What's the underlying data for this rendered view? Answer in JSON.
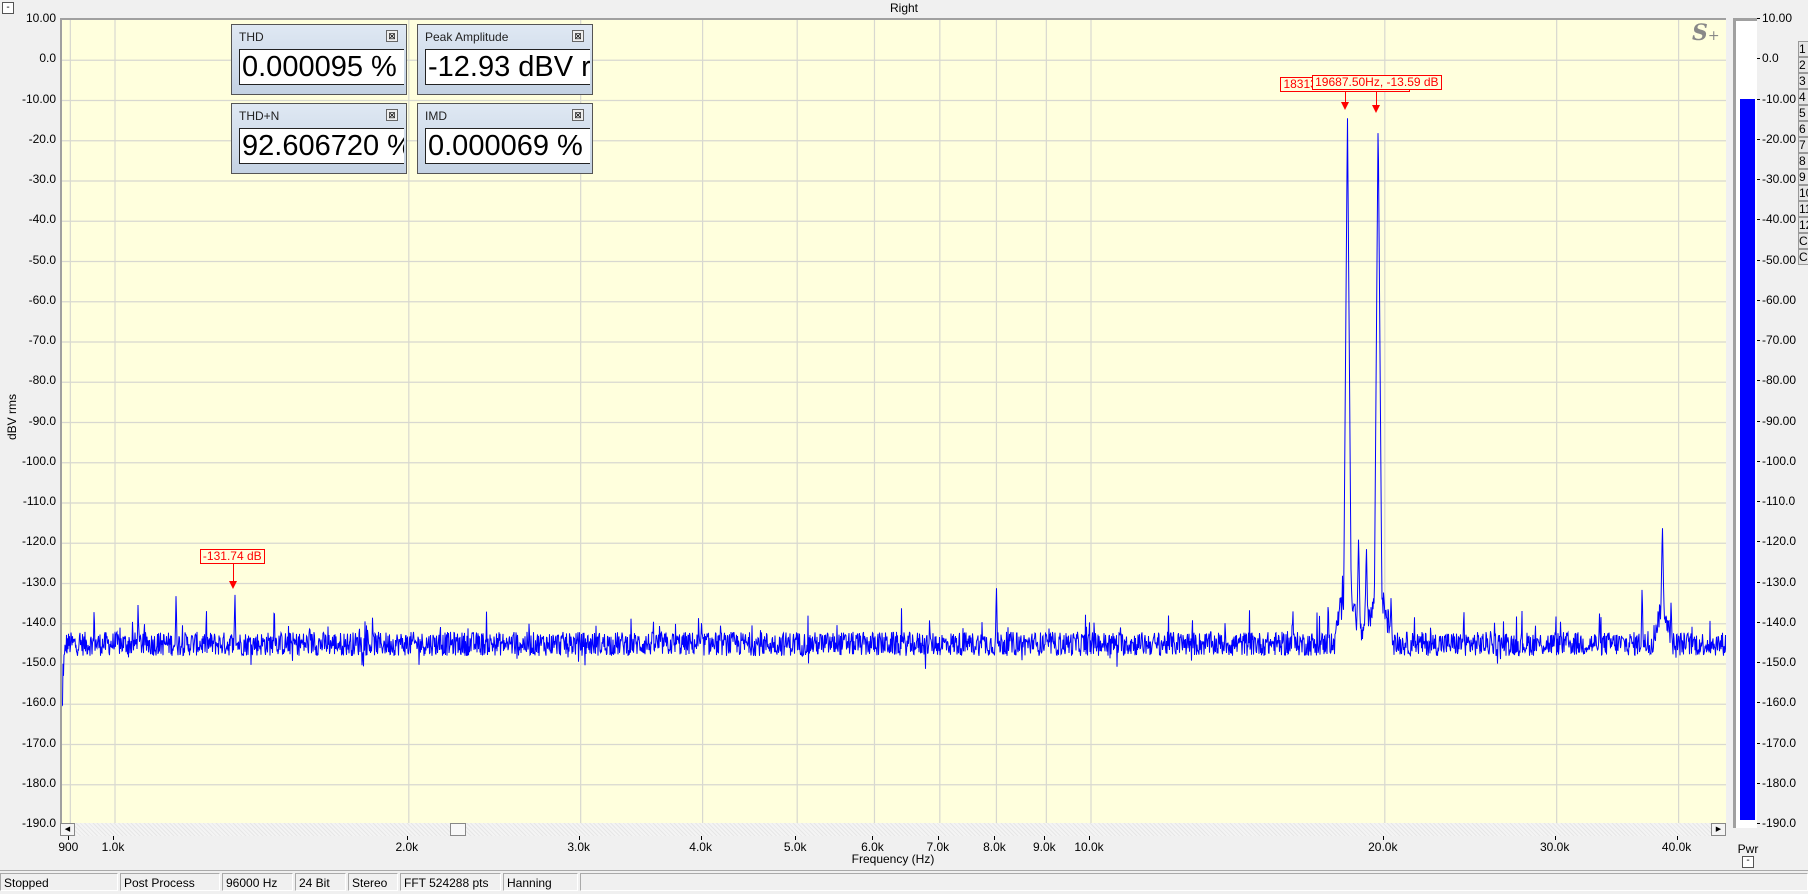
{
  "window": {
    "title": "Right",
    "collapse_label": "-"
  },
  "measurements": [
    {
      "title": "THD",
      "value": "0.000095 %"
    },
    {
      "title": "Peak Amplitude",
      "value": "-12.93 dBV r"
    },
    {
      "title": "THD+N",
      "value": "92.606720 %"
    },
    {
      "title": "IMD",
      "value": "0.000069 %"
    }
  ],
  "logo": {
    "text": "S",
    "plus": "+"
  },
  "markers": [
    {
      "freq_hz": 1327,
      "db": -131.74,
      "label": "-131.74 dB"
    },
    {
      "freq_hz": 18313.42,
      "db": -12.93,
      "label": "18313.42Hz, -12.93 dB"
    },
    {
      "freq_hz": 19687.5,
      "db": -13.59,
      "label": "19687.50Hz, -13.59 dB"
    }
  ],
  "meter": {
    "label": "Pwr",
    "level_db": -10,
    "color": "#0000ff",
    "ticks": [
      "10.00",
      "0.0",
      "-10.00",
      "-20.00",
      "-30.00",
      "-40.00",
      "-50.00",
      "-60.00",
      "-70.00",
      "-80.00",
      "-90.00",
      "-100.0",
      "-110.0",
      "-120.0",
      "-130.0",
      "-140.0",
      "-150.0",
      "-160.0",
      "-170.0",
      "-180.0",
      "-190.0"
    ],
    "collapse_label": "-"
  },
  "side_buttons": [
    "1",
    "2",
    "3",
    "4",
    "5",
    "6",
    "7",
    "8",
    "9",
    "10",
    "11",
    "12",
    "C",
    "C"
  ],
  "chart_data": {
    "type": "line",
    "xlabel": "Frequency (Hz)",
    "ylabel": "dBV rms",
    "x_scale": "log",
    "xlim": [
      883,
      45000
    ],
    "ylim": [
      -190,
      10
    ],
    "grid": true,
    "line_color": "#0000ff",
    "background": "#ffffdd",
    "y_ticks": [
      "10.00",
      "0.0",
      "-10.00",
      "-20.0",
      "-30.0",
      "-40.0",
      "-50.0",
      "-60.0",
      "-70.0",
      "-80.0",
      "-90.0",
      "-100.0",
      "-110.0",
      "-120.0",
      "-130.0",
      "-140.0",
      "-150.0",
      "-160.0",
      "-170.0",
      "-180.0",
      "-190.0"
    ],
    "x_ticks": [
      {
        "value": 900,
        "label": "900"
      },
      {
        "value": 1000,
        "label": "1.0k"
      },
      {
        "value": 2000,
        "label": "2.0k"
      },
      {
        "value": 3000,
        "label": "3.0k"
      },
      {
        "value": 4000,
        "label": "4.0k"
      },
      {
        "value": 5000,
        "label": "5.0k"
      },
      {
        "value": 6000,
        "label": "6.0k"
      },
      {
        "value": 7000,
        "label": "7.0k"
      },
      {
        "value": 8000,
        "label": "8.0k"
      },
      {
        "value": 9000,
        "label": "9.0k"
      },
      {
        "value": 10000,
        "label": "10.0k"
      },
      {
        "value": 20000,
        "label": "20.0k"
      },
      {
        "value": 30000,
        "label": "30.0k"
      },
      {
        "value": 40000,
        "label": "40.0k"
      }
    ],
    "noise_floor_db": -145,
    "peaks": [
      {
        "f": 952,
        "db": -135
      },
      {
        "f": 1056,
        "db": -134
      },
      {
        "f": 1155,
        "db": -132
      },
      {
        "f": 1240,
        "db": -138
      },
      {
        "f": 1327,
        "db": -131.74
      },
      {
        "f": 1456,
        "db": -134
      },
      {
        "f": 1600,
        "db": -139
      },
      {
        "f": 1780,
        "db": -140
      },
      {
        "f": 8000,
        "db": -130
      },
      {
        "f": 16100,
        "db": -135
      },
      {
        "f": 17500,
        "db": -133
      },
      {
        "f": 18100,
        "db": -128
      },
      {
        "f": 18313,
        "db": -12.93
      },
      {
        "f": 18800,
        "db": -118
      },
      {
        "f": 19150,
        "db": -120
      },
      {
        "f": 19688,
        "db": -13.59
      },
      {
        "f": 20300,
        "db": -132
      },
      {
        "f": 24100,
        "db": -135
      },
      {
        "f": 36700,
        "db": -130
      },
      {
        "f": 38500,
        "db": -115
      },
      {
        "f": 39300,
        "db": -133
      }
    ]
  },
  "status_bar": [
    "Stopped",
    "Post Process",
    "96000 Hz",
    "24 Bit",
    "Stereo",
    "FFT 524288 pts",
    "Hanning",
    ""
  ]
}
